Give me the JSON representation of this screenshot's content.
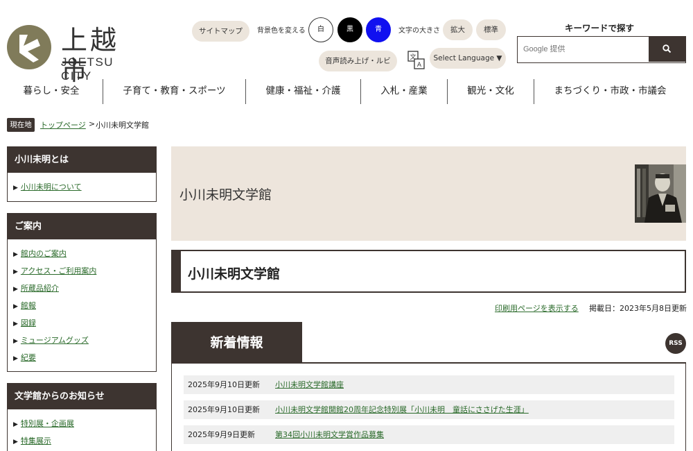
{
  "header": {
    "logo": {
      "jp": "上越市",
      "en": "JOETSU CITY"
    },
    "sitemap": "サイトマップ",
    "bg_label": "背景色を変える",
    "bg_options": [
      "白",
      "黒",
      "青"
    ],
    "font_label": "文字の大きさ",
    "font_options": [
      "拡大",
      "標準"
    ],
    "readaloud": "音声読み上げ・ルビ",
    "language": "Select Language ▼",
    "keyword_title": "キーワードで探す",
    "search_placeholder": "Google 提供"
  },
  "nav": [
    "暮らし・安全",
    "子育て・教育・スポーツ",
    "健康・福祉・介護",
    "入札・産業",
    "観光・文化",
    "まちづくり・市政・市議会"
  ],
  "breadcrumb": {
    "label": "現在地",
    "home": "トップページ",
    "separator": ">",
    "current": "小川未明文学館"
  },
  "sidebar": [
    {
      "title": "小川未明とは",
      "items": [
        "小川未明について"
      ]
    },
    {
      "title": "ご案内",
      "items": [
        "館内のご案内",
        "アクセス・ご利用案内",
        "所蔵品紹介",
        "館報",
        "図録",
        "ミュージアムグッズ",
        "紀要"
      ]
    },
    {
      "title": "文学館からのお知らせ",
      "items": [
        "特別展・企画展",
        "特集展示"
      ]
    }
  ],
  "main": {
    "banner_title": "小川未明文学館",
    "page_title": "小川未明文学館",
    "print_link": "印刷用ページを表示する",
    "published": "掲載日：2023年5月8日更新",
    "news_title": "新着情報",
    "rss": "RSS",
    "news": [
      {
        "date": "2025年9月10日更新",
        "title": "小川未明文学館講座"
      },
      {
        "date": "2025年9月10日更新",
        "title": "小川未明文学館開館20周年記念特別展「小川未明　童話にささげた生涯」"
      },
      {
        "date": "2025年9月9日更新",
        "title": "第34回小川未明文学賞作品募集"
      }
    ]
  },
  "colors": {
    "brand_dark": "#3d3430",
    "banner_bg": "#ede5dc",
    "logo_olive": "#807b5a",
    "link": "#2a6a2a"
  }
}
